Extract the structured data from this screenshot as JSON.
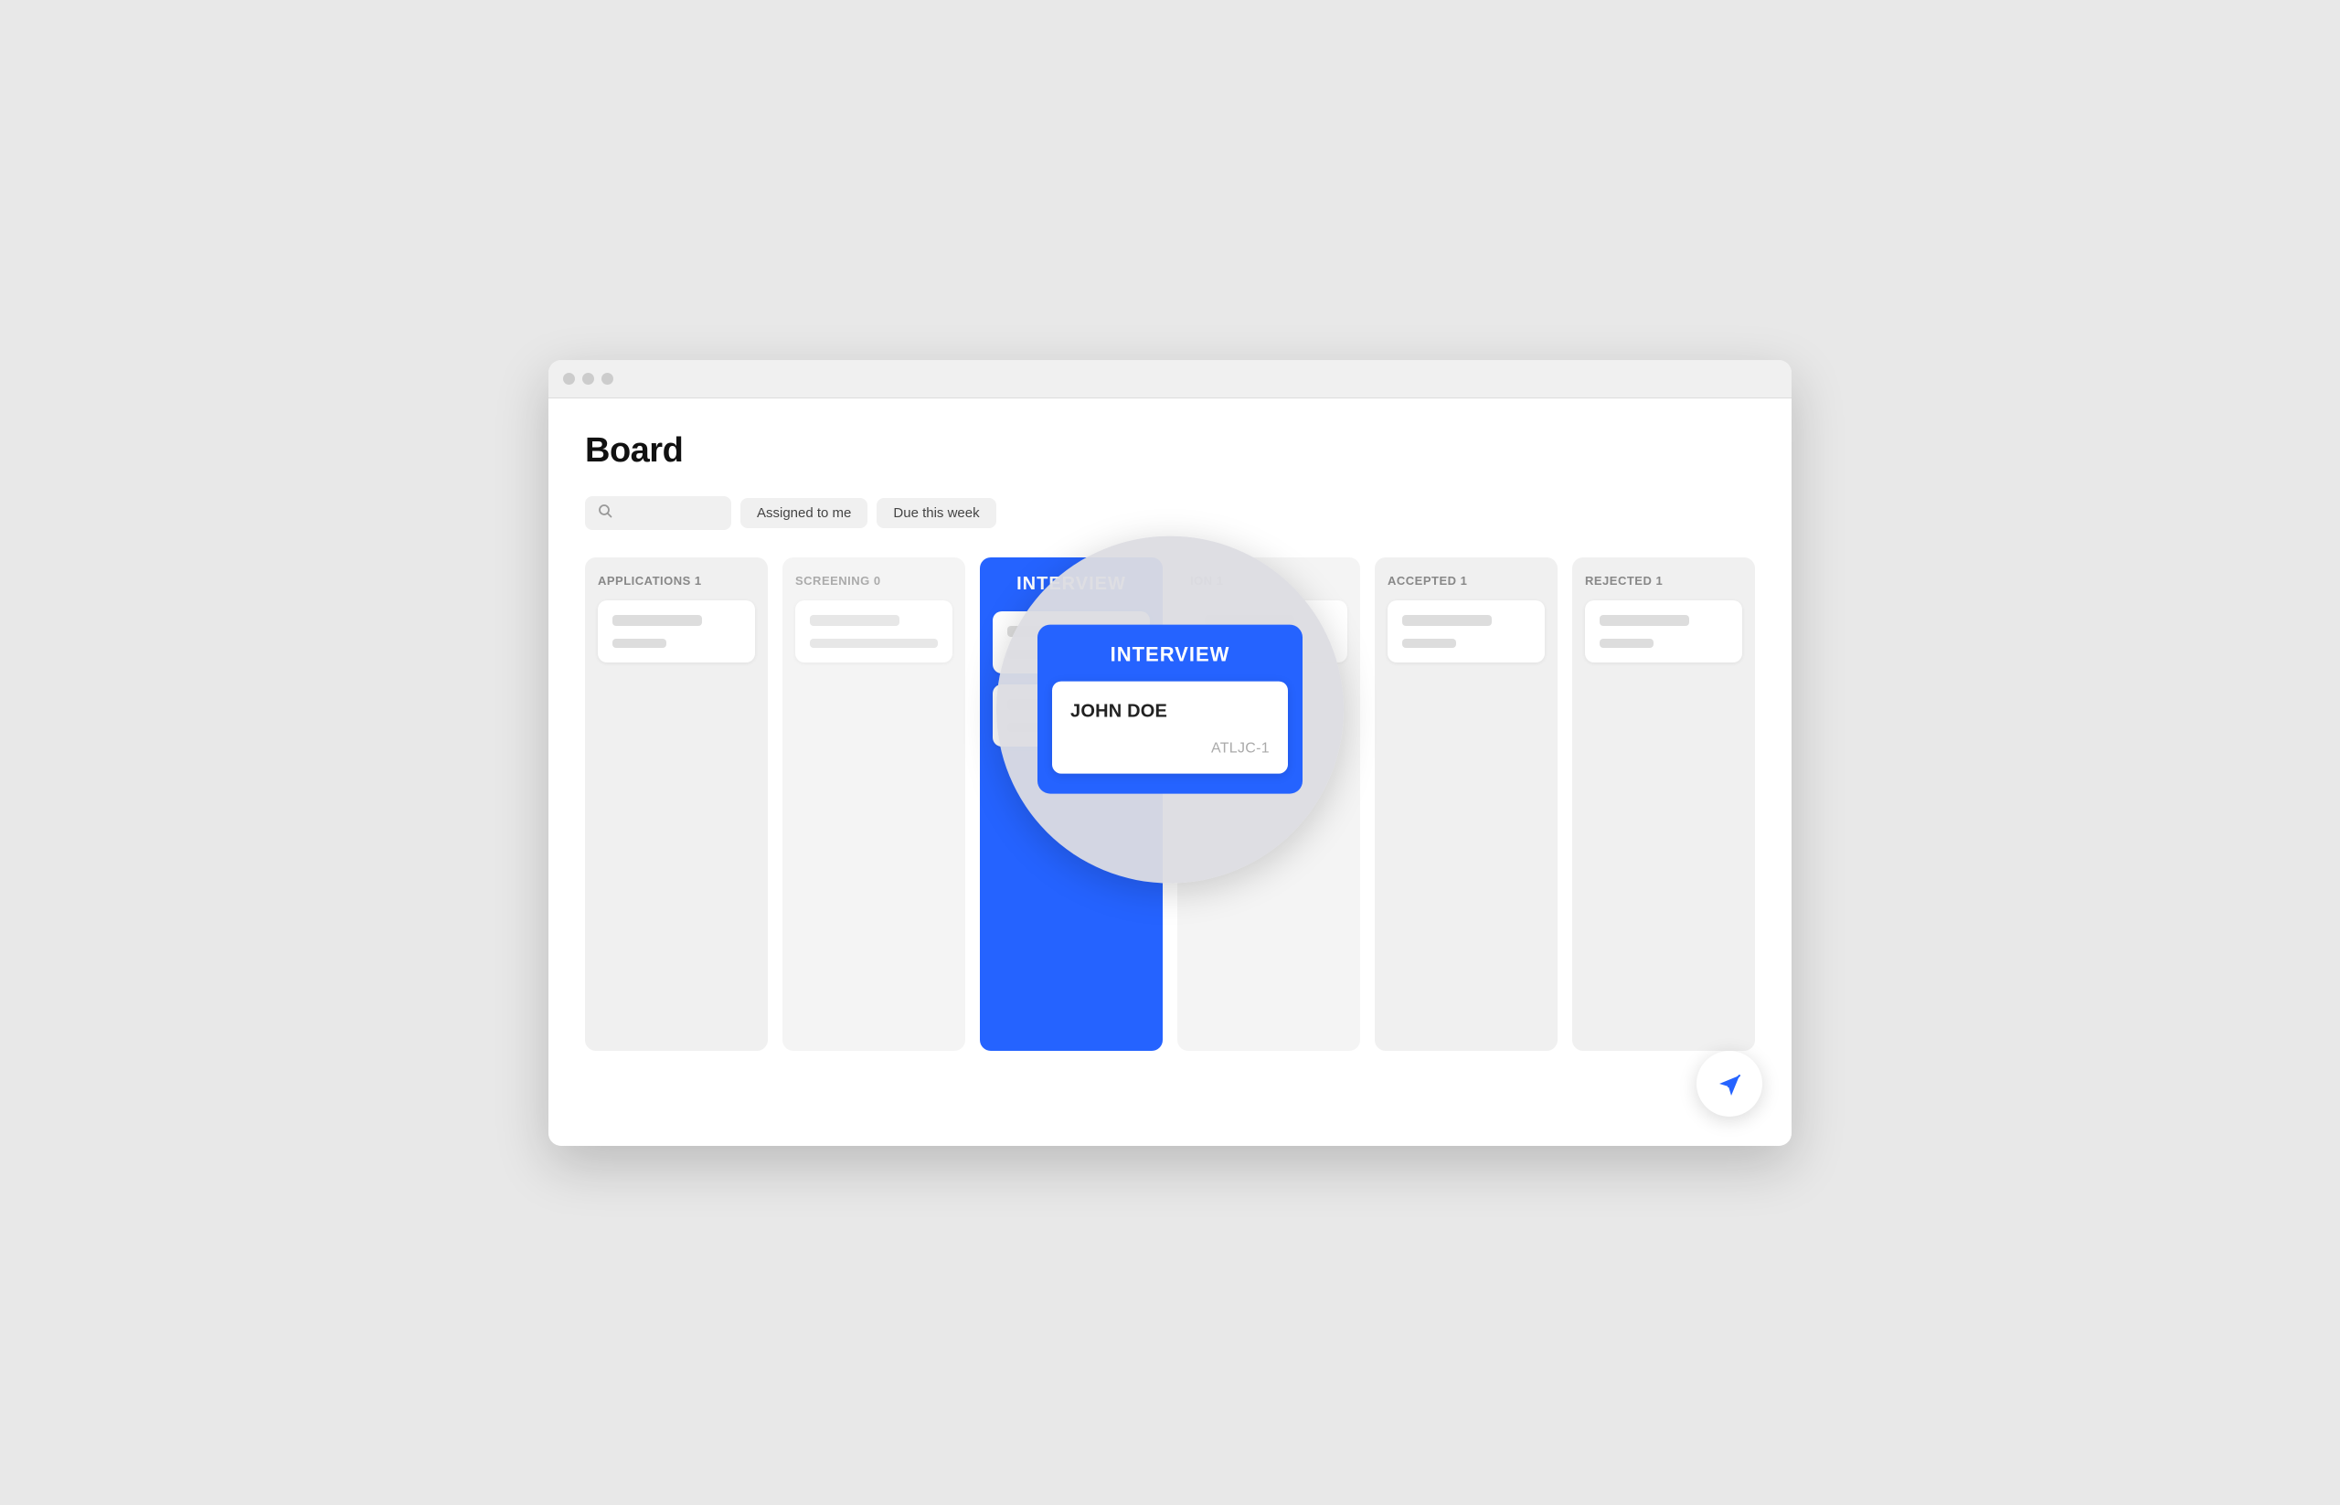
{
  "window": {
    "title": "Board"
  },
  "header": {
    "title": "Board"
  },
  "toolbar": {
    "search_placeholder": "",
    "filter1_label": "Assigned to me",
    "filter2_label": "Due this week"
  },
  "columns": [
    {
      "id": "applications",
      "header": "APPLICATIONS 1",
      "cards": [
        {
          "bar1": "medium",
          "bar2": "short"
        }
      ]
    },
    {
      "id": "screening",
      "header": "SCREENING 0",
      "cards": [
        {
          "bar1": "medium",
          "bar2": "xshort"
        }
      ]
    },
    {
      "id": "interview",
      "header": "INTERVIEW",
      "cards": [
        {
          "bar1": "medium",
          "bar2": "short"
        }
      ],
      "highlighted": true
    },
    {
      "id": "offer",
      "header": "ION 1",
      "cards": [
        {
          "bar1": "medium",
          "bar2": "short"
        }
      ]
    },
    {
      "id": "accepted",
      "header": "ACCEPTED 1",
      "cards": [
        {
          "bar1": "medium",
          "bar2": "short"
        }
      ]
    },
    {
      "id": "rejected",
      "header": "REJECTED 1",
      "cards": [
        {
          "bar1": "medium",
          "bar2": "short"
        }
      ]
    }
  ],
  "magnifier": {
    "column_title": "INTERVIEW",
    "card_name": "JOHN DOE",
    "card_id": "ATLJC-1"
  },
  "fab": {
    "label": "send"
  },
  "colors": {
    "blue_accent": "#2563FF",
    "background": "#f5f5f5",
    "column_bg": "#f0f0f0"
  }
}
